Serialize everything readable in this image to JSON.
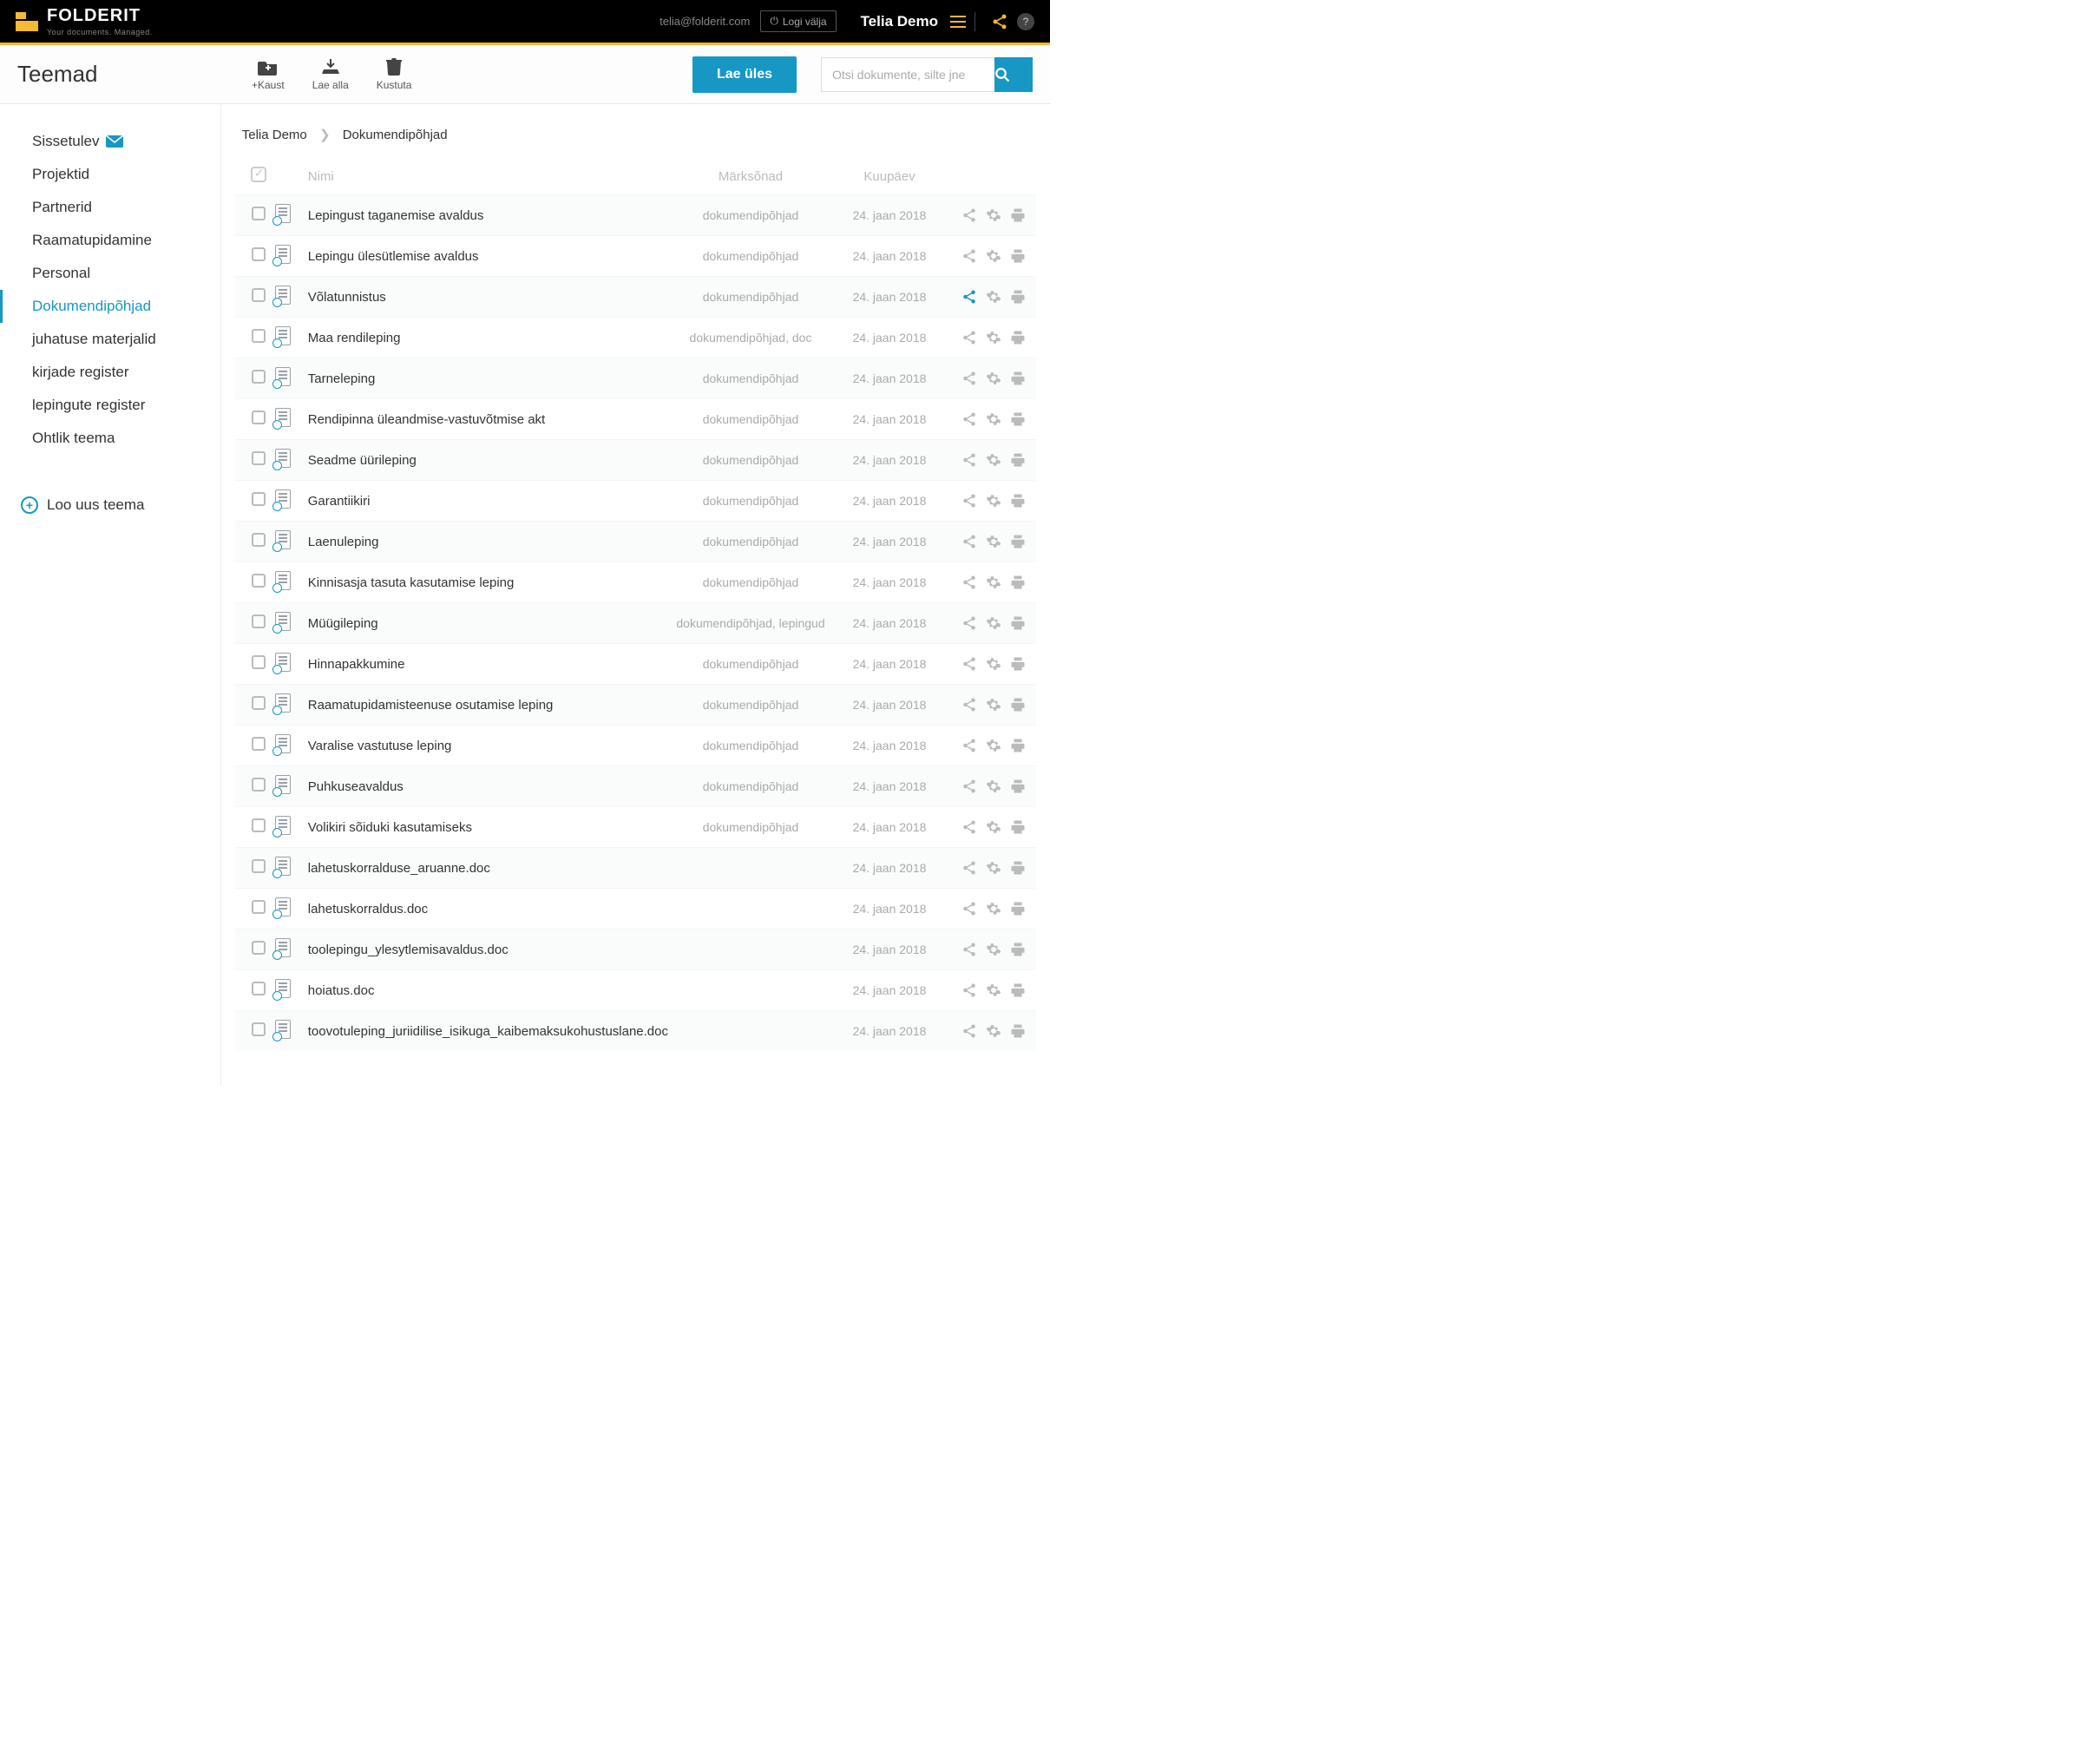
{
  "topbar": {
    "brand": "FOLDERIT",
    "tagline": "Your documents. Managed.",
    "user_email": "telia@folderit.com",
    "logout_label": "Logi välja",
    "account_name": "Telia Demo"
  },
  "toolbar": {
    "page_title": "Teemad",
    "new_folder_label": "+Kaust",
    "download_label": "Lae alla",
    "delete_label": "Kustuta",
    "upload_label": "Lae üles",
    "search_placeholder": "Otsi dokumente, silte jne"
  },
  "sidebar": {
    "items": [
      {
        "label": "Sissetulev",
        "mail": true,
        "active": false
      },
      {
        "label": "Projektid",
        "mail": false,
        "active": false
      },
      {
        "label": "Partnerid",
        "mail": false,
        "active": false
      },
      {
        "label": "Raamatupidamine",
        "mail": false,
        "active": false
      },
      {
        "label": "Personal",
        "mail": false,
        "active": false
      },
      {
        "label": "Dokumendipõhjad",
        "mail": false,
        "active": true
      },
      {
        "label": "juhatuse materjalid",
        "mail": false,
        "active": false
      },
      {
        "label": "kirjade register",
        "mail": false,
        "active": false
      },
      {
        "label": "lepingute register",
        "mail": false,
        "active": false
      },
      {
        "label": "Ohtlik teema",
        "mail": false,
        "active": false
      }
    ],
    "new_topic_label": "Loo uus teema"
  },
  "breadcrumb": {
    "root": "Telia Demo",
    "current": "Dokumendipõhjad"
  },
  "columns": {
    "name": "Nimi",
    "tags": "Märksõnad",
    "date": "Kuupäev"
  },
  "rows": [
    {
      "name": "Lepingust taganemise avaldus",
      "tags": "dokumendipõhjad",
      "date": "24. jaan 2018",
      "share_active": false
    },
    {
      "name": "Lepingu ülesütlemise avaldus",
      "tags": "dokumendipõhjad",
      "date": "24. jaan 2018",
      "share_active": false
    },
    {
      "name": "Võlatunnistus",
      "tags": "dokumendipõhjad",
      "date": "24. jaan 2018",
      "share_active": true
    },
    {
      "name": "Maa rendileping",
      "tags": "dokumendipõhjad, doc",
      "date": "24. jaan 2018",
      "share_active": false
    },
    {
      "name": "Tarneleping",
      "tags": "dokumendipõhjad",
      "date": "24. jaan 2018",
      "share_active": false
    },
    {
      "name": "Rendipinna üleandmise-vastuvõtmise akt",
      "tags": "dokumendipõhjad",
      "date": "24. jaan 2018",
      "share_active": false
    },
    {
      "name": "Seadme üürileping",
      "tags": "dokumendipõhjad",
      "date": "24. jaan 2018",
      "share_active": false
    },
    {
      "name": "Garantiikiri",
      "tags": "dokumendipõhjad",
      "date": "24. jaan 2018",
      "share_active": false
    },
    {
      "name": "Laenuleping",
      "tags": "dokumendipõhjad",
      "date": "24. jaan 2018",
      "share_active": false
    },
    {
      "name": "Kinnisasja tasuta kasutamise leping",
      "tags": "dokumendipõhjad",
      "date": "24. jaan 2018",
      "share_active": false
    },
    {
      "name": "Müügileping",
      "tags": "dokumendipõhjad, lepingud",
      "date": "24. jaan 2018",
      "share_active": false
    },
    {
      "name": "Hinnapakkumine",
      "tags": "dokumendipõhjad",
      "date": "24. jaan 2018",
      "share_active": false
    },
    {
      "name": "Raamatupidamisteenuse osutamise leping",
      "tags": "dokumendipõhjad",
      "date": "24. jaan 2018",
      "share_active": false
    },
    {
      "name": "Varalise vastutuse leping",
      "tags": "dokumendipõhjad",
      "date": "24. jaan 2018",
      "share_active": false
    },
    {
      "name": "Puhkuseavaldus",
      "tags": "dokumendipõhjad",
      "date": "24. jaan 2018",
      "share_active": false
    },
    {
      "name": "Volikiri sõiduki kasutamiseks",
      "tags": "dokumendipõhjad",
      "date": "24. jaan 2018",
      "share_active": false
    },
    {
      "name": "lahetuskorralduse_aruanne.doc",
      "tags": "",
      "date": "24. jaan 2018",
      "share_active": false
    },
    {
      "name": "lahetuskorraldus.doc",
      "tags": "",
      "date": "24. jaan 2018",
      "share_active": false
    },
    {
      "name": "toolepingu_ylesytlemisavaldus.doc",
      "tags": "",
      "date": "24. jaan 2018",
      "share_active": false
    },
    {
      "name": "hoiatus.doc",
      "tags": "",
      "date": "24. jaan 2018",
      "share_active": false
    },
    {
      "name": "toovotuleping_juriidilise_isikuga_kaibemaksukohustuslane.doc",
      "tags": "",
      "date": "24. jaan 2018",
      "share_active": false
    }
  ]
}
